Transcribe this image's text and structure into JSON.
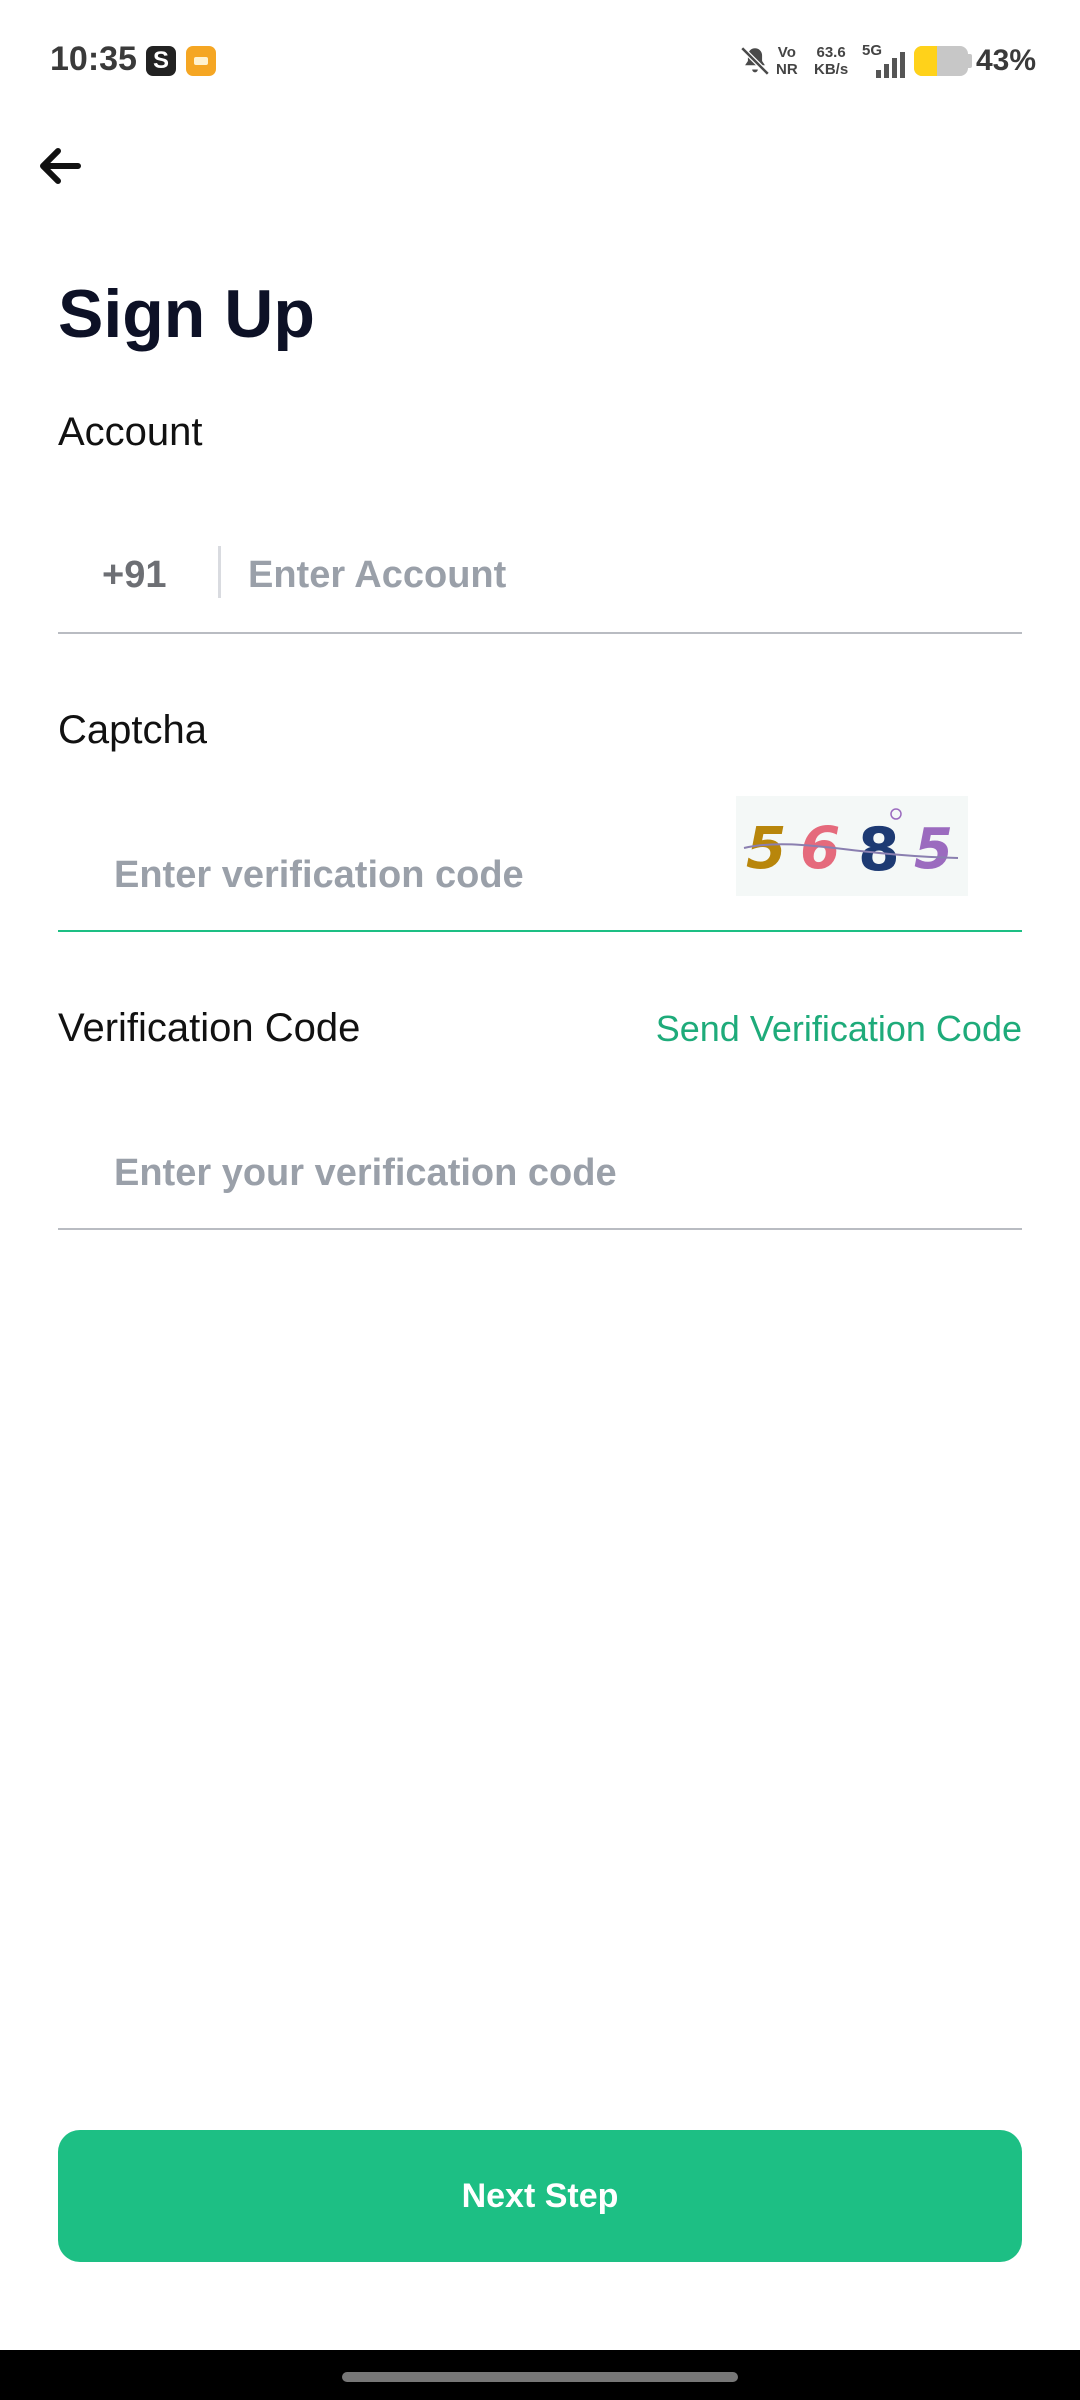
{
  "status_bar": {
    "time": "10:35",
    "app_badge": "S",
    "volte_top": "Vo",
    "volte_bottom": "NR",
    "speed_value": "63.6",
    "speed_unit": "KB/s",
    "network": "5G",
    "battery_percent": "43%",
    "battery_level": 0.43
  },
  "header": {
    "title": "Sign Up"
  },
  "form": {
    "account": {
      "label": "Account",
      "country_code": "+91",
      "placeholder": "Enter Account"
    },
    "captcha": {
      "label": "Captcha",
      "placeholder": "Enter verification code",
      "image_digits": [
        "5",
        "6",
        "8",
        "5"
      ],
      "digit_colors": [
        "#b8860b",
        "#e56a7c",
        "#1d3a73",
        "#9b6bbf"
      ]
    },
    "verification": {
      "label": "Verification Code",
      "send_link": "Send Verification Code",
      "placeholder": "Enter your verification code"
    }
  },
  "actions": {
    "next_label": "Next Step"
  },
  "colors": {
    "accent": "#1dbf84",
    "link": "#1eab7a"
  }
}
